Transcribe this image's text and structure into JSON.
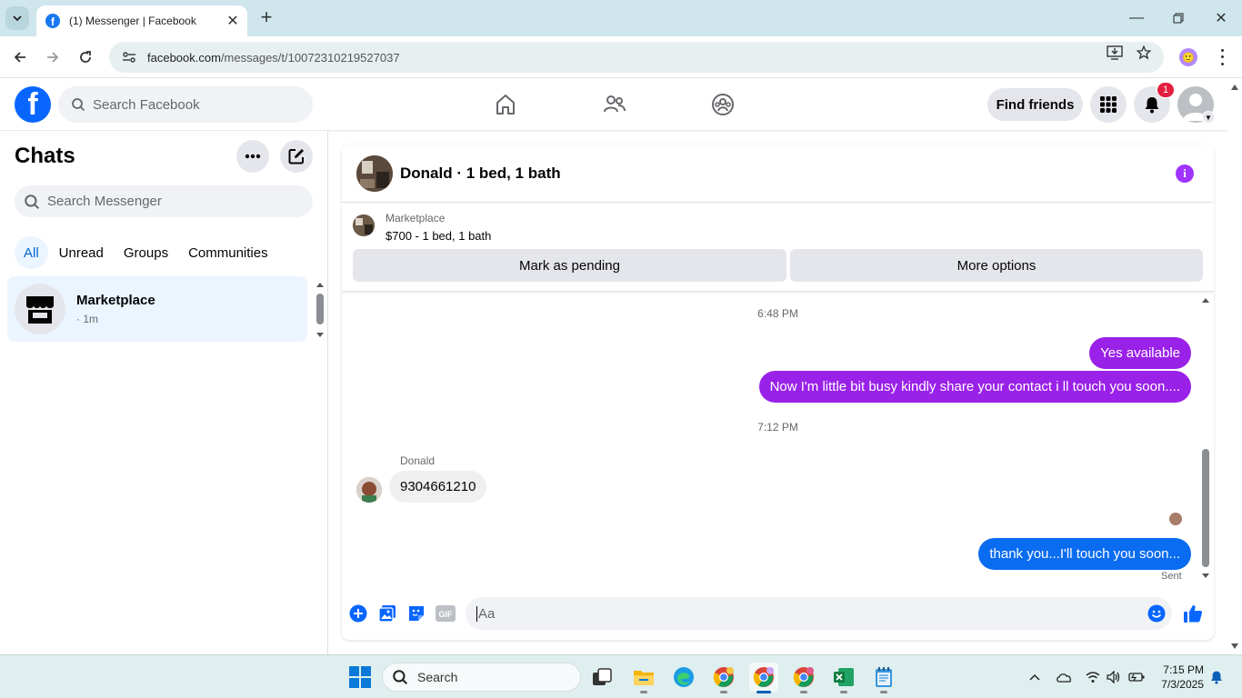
{
  "browser": {
    "tab_title": "(1) Messenger | Facebook",
    "url_host": "facebook.com",
    "url_path": "/messages/t/10072310219527037"
  },
  "facebook": {
    "search_placeholder": "Search Facebook",
    "find_friends": "Find friends",
    "notification_count": "1"
  },
  "chats": {
    "title": "Chats",
    "search_placeholder": "Search Messenger",
    "filters": [
      "All",
      "Unread",
      "Groups",
      "Communities"
    ],
    "active_filter": "All",
    "items": [
      {
        "name": "Marketplace",
        "meta": "· 1m"
      }
    ]
  },
  "conversation": {
    "title": "Donald · 1 bed, 1 bath",
    "listing": {
      "label": "Marketplace",
      "title": "$700 - 1 bed, 1 bath",
      "primary_action": "Mark as pending",
      "secondary_action": "More options"
    },
    "messages": {
      "ts1": "6:48 PM",
      "out1": "Yes available",
      "out2": "Now I'm little bit busy kindly share your contact i ll touch you soon....",
      "ts2": "7:12 PM",
      "in_sender": "Donald",
      "in1": "9304661210",
      "out3": "thank you...I'll touch you soon...",
      "status": "Sent"
    },
    "composer_placeholder": "Aa",
    "colors": {
      "outgoing_purple": "#9a21e8",
      "outgoing_blue": "#0a6cf0",
      "accent": "#0866ff"
    }
  },
  "taskbar": {
    "search_placeholder": "Search",
    "time": "7:15 PM",
    "date": "7/3/2025"
  }
}
